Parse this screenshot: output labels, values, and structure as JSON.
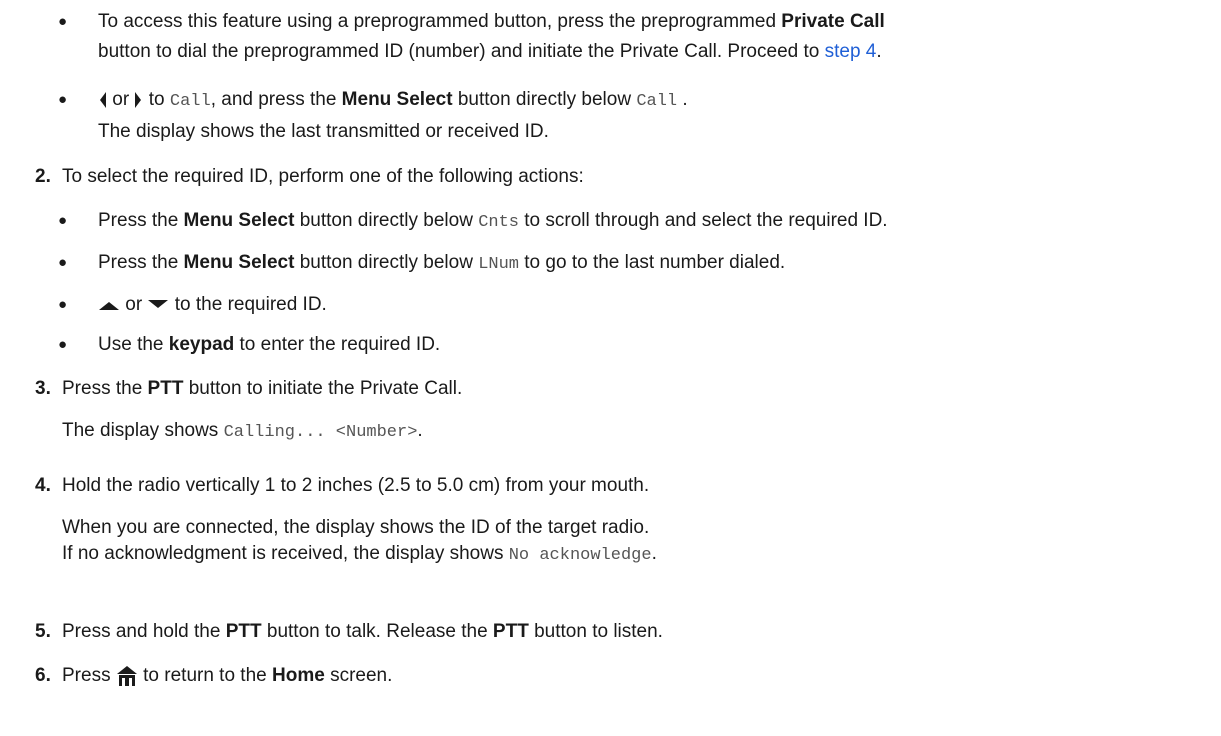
{
  "b1": {
    "pre1": "To access this feature using a preprogrammed button, press the preprogrammed ",
    "bold1": "Private Call",
    "l2a": "button to dial the preprogrammed ID (number) and initiate the Private Call. Proceed to ",
    "link": "step 4",
    "dot": "."
  },
  "b2": {
    "or": "or",
    "to": "to",
    "call1": "Call",
    "mid": ", and press the ",
    "bold": "Menu Select",
    "after": " button directly below ",
    "call2": "Call",
    "end": ".",
    "line2": "The display shows the last transmitted or received ID."
  },
  "s2": {
    "num": "2.",
    "text": "To select the required ID, perform one of the following actions:"
  },
  "s2b1": {
    "pre": "Press the ",
    "bold": "Menu Select",
    "mid": " button directly below ",
    "code": "Cnts",
    "post": " to scroll through and select the required ID."
  },
  "s2b2": {
    "pre": "Press the ",
    "bold": "Menu Select",
    "mid": " button directly below ",
    "code": "LNum",
    "post": " to go to the last number dialed."
  },
  "s2b3": {
    "or": "or",
    "post": "to the required ID."
  },
  "s2b4": {
    "pre": "Use the ",
    "bold": "keypad",
    "post": " to enter the required ID."
  },
  "s3": {
    "num": "3.",
    "pre": "Press the ",
    "bold": "PTT",
    "post": " button to initiate the Private Call.",
    "disp_pre": "The display shows ",
    "code": "Calling... <Number>",
    "end": "."
  },
  "s4": {
    "num": "4.",
    "text": "Hold the radio vertically 1 to 2 inches (2.5 to 5.0 cm) from your mouth.",
    "p1": "When you are connected, the display shows the ID of the target radio.",
    "p2pre": "If no acknowledgment is received, the display shows ",
    "code": "No acknowledge",
    "end": "."
  },
  "s5": {
    "num": "5.",
    "pre": "Press and hold the ",
    "bold1": "PTT",
    "mid": " button to talk. Release the ",
    "bold2": "PTT",
    "post": " button to listen."
  },
  "s6": {
    "num": "6.",
    "pre": "Press",
    "post": "to return to the ",
    "bold": "Home",
    "end": " screen."
  },
  "bullet_char": "●",
  "icons": [
    "left-arrow-icon",
    "right-arrow-icon",
    "up-arrow-icon",
    "down-arrow-icon",
    "home-icon"
  ]
}
